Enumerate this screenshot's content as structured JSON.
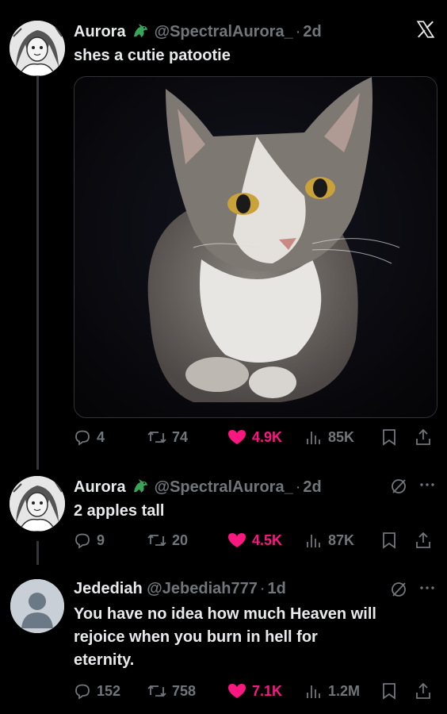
{
  "tweets": [
    {
      "name": "Aurora",
      "handle": "@SpectralAurora_",
      "separator": "·",
      "time": "2d",
      "text": "shes a cutie patootie",
      "replies": "4",
      "retweets": "74",
      "likes": "4.9K",
      "views": "85K"
    },
    {
      "name": "Aurora",
      "handle": "@SpectralAurora_",
      "separator": "·",
      "time": "2d",
      "text": "2 apples tall",
      "replies": "9",
      "retweets": "20",
      "likes": "4.5K",
      "views": "87K"
    },
    {
      "name": "Jedediah",
      "handle": "@Jebediah777",
      "separator": "·",
      "time": "1d",
      "text_lines": [
        "You have no idea how much Heaven will",
        "rejoice when you burn in hell for",
        "eternity."
      ],
      "replies": "152",
      "retweets": "758",
      "likes": "7.1K",
      "views": "1.2M"
    }
  ],
  "icons": {
    "close": "x-logo-icon",
    "badge": "dragon-badge-icon",
    "grok": "grok-icon",
    "more": "more-icon",
    "reply": "reply-icon",
    "retweet": "retweet-icon",
    "like": "heart-icon",
    "views": "views-icon",
    "bookmark": "bookmark-icon",
    "share": "share-icon"
  },
  "colors": {
    "background": "#000000",
    "text": "#e7e9ea",
    "muted": "#71767b",
    "like": "#f91880",
    "badge": "#3aa35a"
  }
}
